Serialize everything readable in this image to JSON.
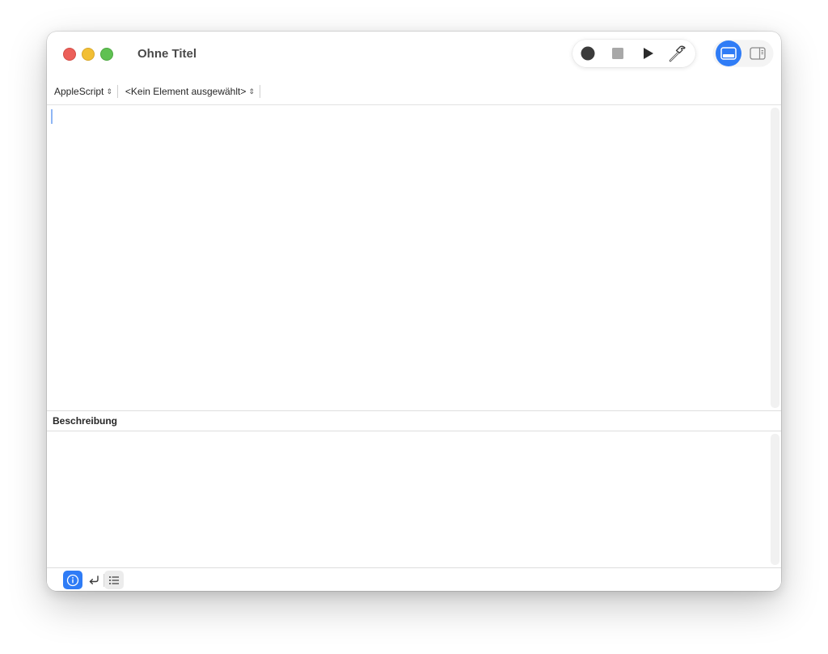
{
  "window": {
    "title": "Ohne Titel"
  },
  "toolbar": {
    "record_icon": "record-icon",
    "stop_icon": "stop-icon",
    "run_icon": "play-icon",
    "compile_icon": "hammer-icon",
    "view_editor_icon": "bottom-panel-icon",
    "view_sidebar_icon": "sidebar-right-icon"
  },
  "navbar": {
    "language": "AppleScript",
    "element": "<Kein Element ausgewählt>"
  },
  "description_panel": {
    "header": "Beschreibung"
  },
  "bottom_bar": {
    "buttons": [
      "info-icon",
      "return-arrow-icon",
      "list-icon"
    ]
  },
  "colors": {
    "accent": "#2f7cf6",
    "close": "#ec5f59",
    "minimize": "#f2bf34",
    "maximize": "#5fc152"
  }
}
